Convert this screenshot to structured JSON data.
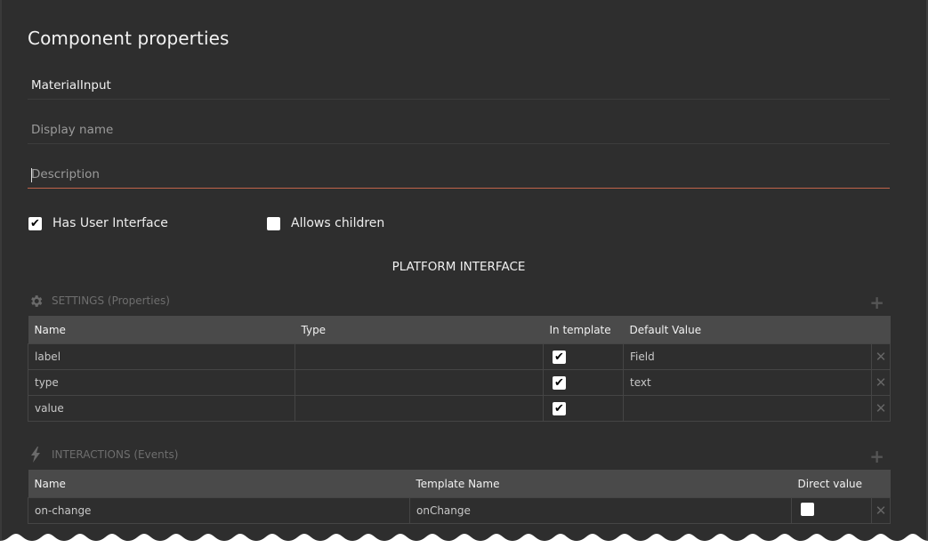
{
  "panel": {
    "title": "Component properties",
    "fields": {
      "component_name": {
        "value": "MaterialInput",
        "placeholder": ""
      },
      "display_name": {
        "value": "",
        "placeholder": "Display name"
      },
      "description": {
        "value": "",
        "placeholder": "Description"
      }
    },
    "checkboxes": {
      "has_user_interface": {
        "label": "Has User Interface",
        "checked": true
      },
      "allows_children": {
        "label": "Allows children",
        "checked": false
      }
    },
    "section_title": "PLATFORM INTERFACE"
  },
  "settings": {
    "heading": "SETTINGS (Properties)",
    "icon": "gear-icon",
    "add_icon": "plus-icon",
    "columns": [
      "Name",
      "Type",
      "In template",
      "Default Value"
    ],
    "rows": [
      {
        "name": "label",
        "type": "",
        "in_template": true,
        "default_value": "Field"
      },
      {
        "name": "type",
        "type": "",
        "in_template": true,
        "default_value": "text"
      },
      {
        "name": "value",
        "type": "",
        "in_template": true,
        "default_value": ""
      }
    ],
    "remove_icon": "close-icon"
  },
  "interactions": {
    "heading": "INTERACTIONS (Events)",
    "icon": "lightning-icon",
    "add_icon": "plus-icon",
    "columns": [
      "Name",
      "Template Name",
      "Direct value"
    ],
    "rows": [
      {
        "name": "on-change",
        "template_name": "onChange",
        "direct_value": false
      }
    ],
    "remove_icon": "close-icon"
  },
  "glyphs": {
    "check": "✔",
    "close": "✕",
    "plus": "+"
  },
  "colors": {
    "background": "#2e2e2e",
    "header": "#4a4a4a",
    "focus_underline": "#c0634a"
  }
}
